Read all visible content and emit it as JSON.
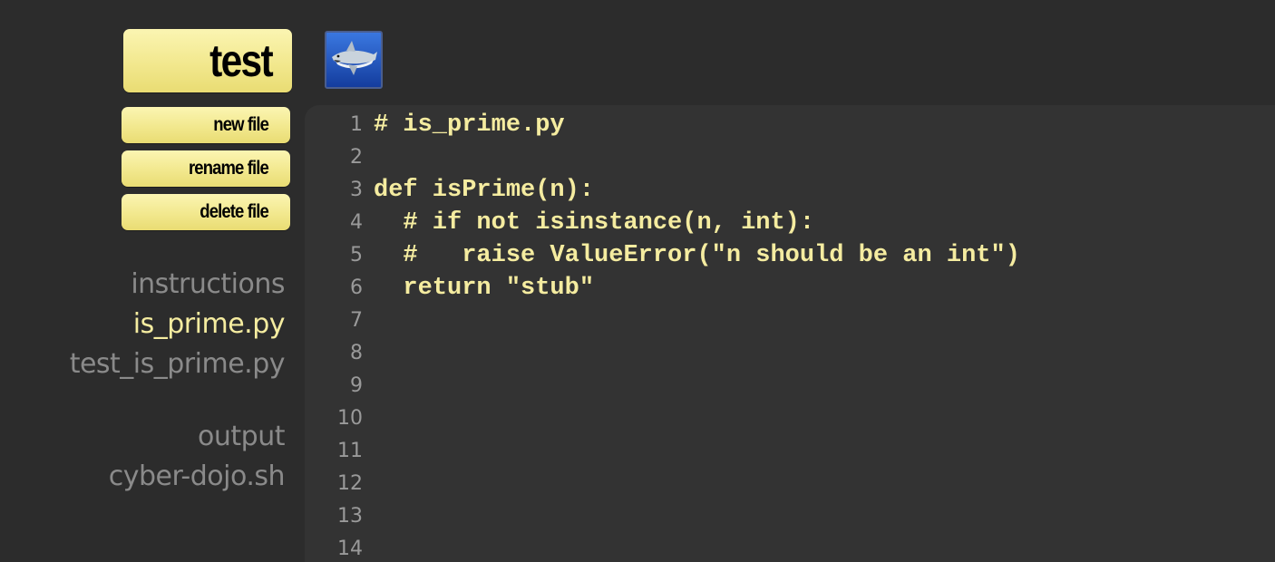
{
  "toolbar": {
    "test_label": "test",
    "new_file_label": "new file",
    "rename_file_label": "rename file",
    "delete_file_label": "delete file"
  },
  "avatar": {
    "icon": "shark-avatar-icon"
  },
  "files": [
    {
      "name": "instructions",
      "selected": false
    },
    {
      "name": "is_prime.py",
      "selected": true
    },
    {
      "name": "test_is_prime.py",
      "selected": false
    },
    {
      "name": "output",
      "selected": false
    },
    {
      "name": "cyber-dojo.sh",
      "selected": false
    }
  ],
  "editor": {
    "line_numbers": [
      "1",
      "2",
      "3",
      "4",
      "5",
      "6",
      "7",
      "8",
      "9",
      "10",
      "11",
      "12",
      "13",
      "14"
    ],
    "lines": [
      "# is_prime.py",
      "",
      "def isPrime(n):",
      "  # if not isinstance(n, int):",
      "  #   raise ValueError(\"n should be an int\")",
      "  return \"stub\"",
      "",
      "",
      "",
      "",
      "",
      "",
      "",
      ""
    ]
  },
  "colors": {
    "background": "#2c2c2c",
    "editor_background": "#333333",
    "code_text": "#f5eca0",
    "button": "#f2e88e"
  }
}
